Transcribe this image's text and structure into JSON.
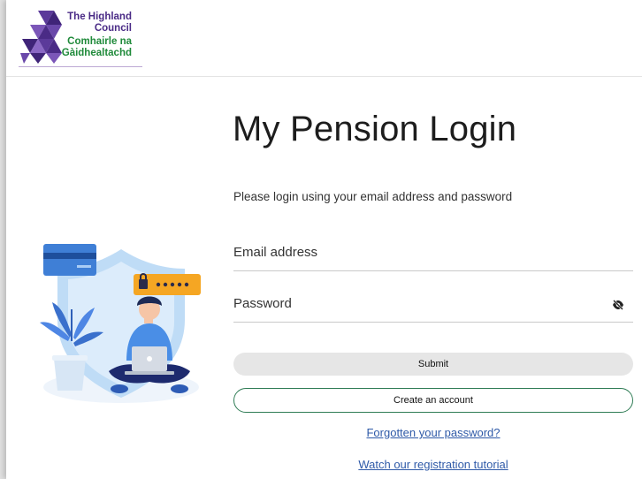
{
  "header": {
    "logo_lines": [
      "The Highland",
      "Council",
      "Comhairle na",
      "Gàidhealtachd"
    ]
  },
  "main": {
    "title": "My Pension Login",
    "subtitle": "Please login using your email address and password",
    "email_label": "Email address",
    "password_label": "Password",
    "password_mask": "•••••",
    "submit_label": "Submit",
    "create_label": "Create an account",
    "forgot_link": "Forgotten your password?",
    "tutorial_link": "Watch our registration tutorial"
  },
  "icons": {
    "password_toggle": "eye-slash-icon",
    "illustration": "security-login-illustration"
  },
  "colors": {
    "brand_purple": "#4a2b86",
    "brand_green": "#1f8a3a",
    "create_border": "#2f7c55",
    "link": "#2f5aa8",
    "submit_bg": "#e6e6e6"
  }
}
